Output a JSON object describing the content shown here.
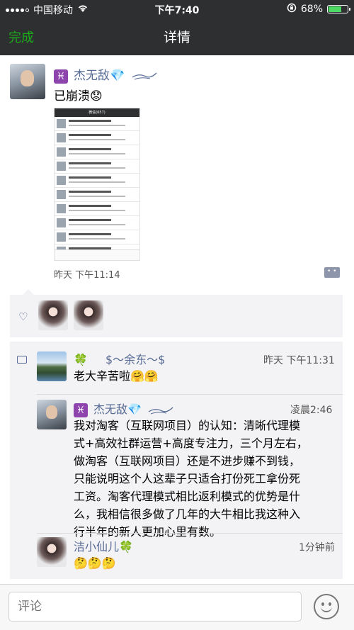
{
  "status_bar": {
    "carrier": "中国移动",
    "time": "下午7:40",
    "battery": "68%",
    "battery_level": 0.68,
    "icons": [
      "signal-icon",
      "wifi-icon",
      "orientation-lock-icon",
      "battery-icon"
    ]
  },
  "nav": {
    "done_label": "完成",
    "title": "详情"
  },
  "post": {
    "author_zodiac": "♓",
    "author_name": "杰无敌💎",
    "text": "已崩溃😟",
    "screenshot_title": "微信(657)",
    "time": "昨天 下午11:14",
    "screenshot_rows": 10
  },
  "likes": {
    "icon": "heart-icon",
    "count": 2
  },
  "comments": [
    {
      "author": "$～余东～$",
      "clover": "🍀",
      "time": "昨天 下午11:31",
      "text": "老大辛苦啦🤗🤗"
    },
    {
      "zodiac": "♓",
      "author": "杰无敌💎",
      "time": "凌晨2:46",
      "lines": [
        "我对淘客（互联网项目）的认知：清晰代理模",
        "式+高效社群运营+高度专注力，三个月左右，",
        "做淘客（互联网项目）还是不进步赚不到钱，",
        "只能说明这个人这辈子只适合打份死工拿份死",
        "工资。淘客代理模式相比返利模式的优势是什",
        "么，我相信很多做了几年的大牛相比我这种入",
        "行半年的新人更加心里有数。"
      ]
    },
    {
      "author": "洁小仙儿",
      "clover": "🍀",
      "time": "1分钟前",
      "text": "🤔🤔🤔"
    }
  ],
  "input": {
    "placeholder": "评论"
  },
  "colors": {
    "bar_bg": "#2e2f31",
    "accent_green": "#1aad19",
    "name_blue": "#576b95",
    "panel_gray": "#f3f3f5"
  }
}
